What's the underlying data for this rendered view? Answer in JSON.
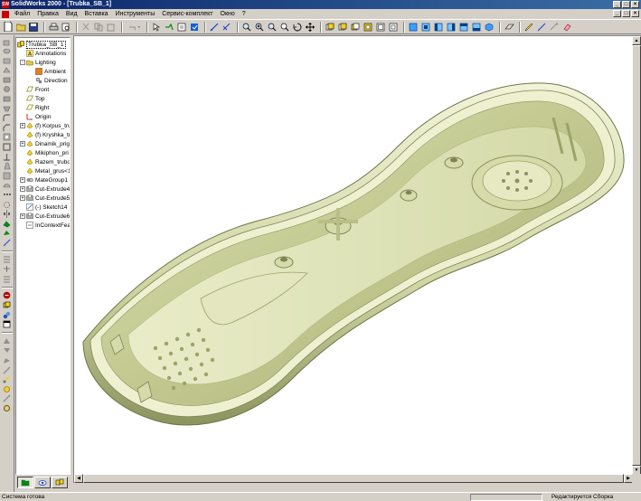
{
  "window": {
    "title": "SolidWorks 2000 - [Trubka_SB_1]",
    "app_icon_text": "SW",
    "controls": [
      "_",
      "□",
      "×"
    ]
  },
  "menu": {
    "items": [
      "Файл",
      "Правка",
      "Вид",
      "Вставка",
      "Инструменты",
      "Сервис-комплект",
      "Окно",
      "?"
    ],
    "doc_controls": [
      "_",
      "□",
      "×"
    ]
  },
  "tree": {
    "items": [
      {
        "label": "Trubka_SB_1",
        "icon": "assembly-icon",
        "indent": 0,
        "expander": "",
        "selected": true
      },
      {
        "label": "Annotations",
        "icon": "annotations-icon",
        "indent": 1,
        "expander": ""
      },
      {
        "label": "Lighting",
        "icon": "lighting-folder-icon",
        "indent": 1,
        "expander": "-"
      },
      {
        "label": "Ambient",
        "icon": "ambient-light-icon",
        "indent": 2,
        "expander": ""
      },
      {
        "label": "Direction",
        "icon": "directional-light-icon",
        "indent": 2,
        "expander": ""
      },
      {
        "label": "Front",
        "icon": "plane-icon",
        "indent": 1,
        "expander": ""
      },
      {
        "label": "Top",
        "icon": "plane-icon",
        "indent": 1,
        "expander": ""
      },
      {
        "label": "Right",
        "icon": "plane-icon",
        "indent": 1,
        "expander": ""
      },
      {
        "label": "Origin",
        "icon": "origin-icon",
        "indent": 1,
        "expander": ""
      },
      {
        "label": "(f) Korpus_tru",
        "icon": "part-icon",
        "indent": 1,
        "expander": "+"
      },
      {
        "label": "(f) Kryshka_tru",
        "icon": "part-icon",
        "indent": 1,
        "expander": ""
      },
      {
        "label": "Dinamik_prig",
        "icon": "part-icon",
        "indent": 1,
        "expander": "+"
      },
      {
        "label": "Mikiphon_pri",
        "icon": "part-icon",
        "indent": 1,
        "expander": ""
      },
      {
        "label": "Razem_trubo",
        "icon": "part-icon",
        "indent": 1,
        "expander": ""
      },
      {
        "label": "Metal_grus<1",
        "icon": "part-icon",
        "indent": 1,
        "expander": ""
      },
      {
        "label": "MateGroup1",
        "icon": "mategroup-icon",
        "indent": 1,
        "expander": "+"
      },
      {
        "label": "Cut-Extrude4",
        "icon": "cut-extrude-icon",
        "indent": 1,
        "expander": "+"
      },
      {
        "label": "Cut-Extrude5",
        "icon": "cut-extrude-icon",
        "indent": 1,
        "expander": "+"
      },
      {
        "label": "(-) Sketch14",
        "icon": "sketch-icon",
        "indent": 1,
        "expander": ""
      },
      {
        "label": "Cut-Extrude6",
        "icon": "cut-extrude-icon",
        "indent": 1,
        "expander": "+"
      },
      {
        "label": "InContextFea",
        "icon": "incontext-icon",
        "indent": 1,
        "expander": ""
      }
    ],
    "tabs": [
      "feature-manager-tab",
      "property-manager-tab",
      "configuration-manager-tab"
    ]
  },
  "status": {
    "left": "Система готова",
    "right": "Редактируется Сборка"
  },
  "colors": {
    "model_light": "#eef0d0",
    "model_mid": "#c9cf9a",
    "model_dark": "#7d8456",
    "titlebar": "#0a246a"
  }
}
